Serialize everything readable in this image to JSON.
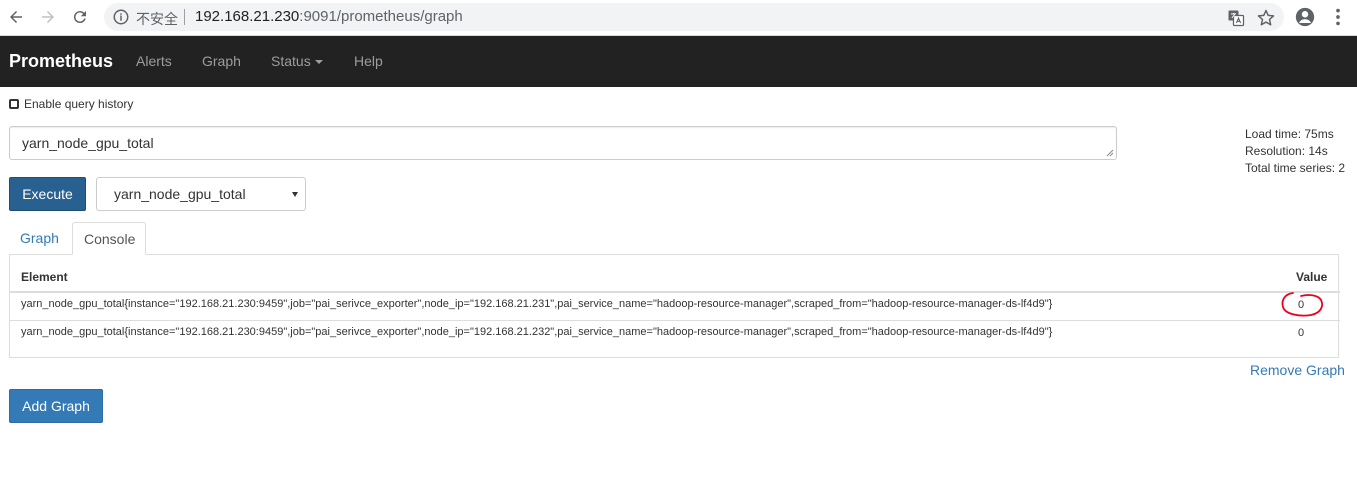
{
  "browser": {
    "insecure_label": "不安全",
    "url_host": "192.168.21.230",
    "url_rest": ":9091/prometheus/graph"
  },
  "navbar": {
    "brand": "Prometheus",
    "links": [
      {
        "label": "Alerts"
      },
      {
        "label": "Graph"
      },
      {
        "label": "Status"
      },
      {
        "label": "Help"
      }
    ]
  },
  "query": {
    "history_label": "Enable query history",
    "expression": "yarn_node_gpu_total",
    "execute_label": "Execute",
    "selected_metric": "yarn_node_gpu_total"
  },
  "stats": {
    "load_time": "Load time: 75ms",
    "resolution": "Resolution: 14s",
    "total_series": "Total time series: 2"
  },
  "tabs": [
    {
      "label": "Graph",
      "active": false
    },
    {
      "label": "Console",
      "active": true
    }
  ],
  "table": {
    "headers": {
      "element": "Element",
      "value": "Value"
    },
    "rows": [
      {
        "element": "yarn_node_gpu_total{instance=\"192.168.21.230:9459\",job=\"pai_serivce_exporter\",node_ip=\"192.168.21.231\",pai_service_name=\"hadoop-resource-manager\",scraped_from=\"hadoop-resource-manager-ds-lf4d9\"}",
        "value": "0"
      },
      {
        "element": "yarn_node_gpu_total{instance=\"192.168.21.230:9459\",job=\"pai_serivce_exporter\",node_ip=\"192.168.21.232\",pai_service_name=\"hadoop-resource-manager\",scraped_from=\"hadoop-resource-manager-ds-lf4d9\"}",
        "value": "0"
      }
    ]
  },
  "actions": {
    "remove_graph": "Remove Graph",
    "add_graph": "Add Graph"
  },
  "colors": {
    "navbar_bg": "#222222",
    "execute_bg": "#286090",
    "link": "#337ab7",
    "annotation_circle": "#e8001c"
  }
}
